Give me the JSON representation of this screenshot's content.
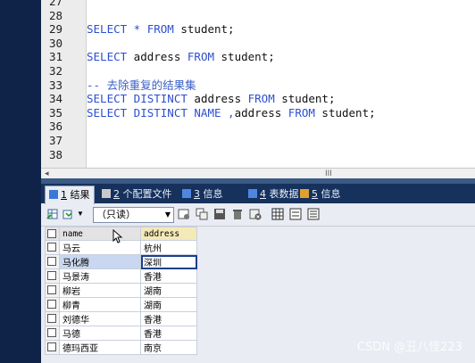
{
  "editor": {
    "lines": [
      {
        "num": "27",
        "segments": []
      },
      {
        "num": "28",
        "segments": []
      },
      {
        "num": "29",
        "segments": [
          {
            "t": "SELECT * FROM",
            "c": "kw"
          },
          {
            "t": " student;",
            "c": ""
          }
        ]
      },
      {
        "num": "30",
        "segments": []
      },
      {
        "num": "31",
        "segments": [
          {
            "t": "SELECT",
            "c": "kw"
          },
          {
            "t": " address ",
            "c": ""
          },
          {
            "t": "FROM",
            "c": "kw"
          },
          {
            "t": " student;",
            "c": ""
          }
        ]
      },
      {
        "num": "32",
        "segments": []
      },
      {
        "num": "33",
        "segments": [
          {
            "t": "-- 去除重复的结果集",
            "c": "cm"
          }
        ]
      },
      {
        "num": "34",
        "segments": [
          {
            "t": "SELECT DISTINCT",
            "c": "kw"
          },
          {
            "t": " address ",
            "c": ""
          },
          {
            "t": "FROM",
            "c": "kw"
          },
          {
            "t": " student;",
            "c": ""
          }
        ]
      },
      {
        "num": "35",
        "segments": [
          {
            "t": "SELECT DISTINCT NAME ,",
            "c": "kw"
          },
          {
            "t": "address ",
            "c": ""
          },
          {
            "t": "FROM",
            "c": "kw"
          },
          {
            "t": " student;",
            "c": ""
          }
        ]
      },
      {
        "num": "36",
        "segments": []
      },
      {
        "num": "37",
        "segments": []
      },
      {
        "num": "38",
        "segments": []
      }
    ],
    "scroll_grip": "III"
  },
  "tabs": [
    {
      "num": "1",
      "label": "结果",
      "active": true,
      "icon": "results-grid-icon",
      "color": "#3a78d6"
    },
    {
      "num": "2",
      "label": "个配置文件",
      "active": false,
      "icon": "profile-icon",
      "color": "#c9c9c9"
    },
    {
      "num": "3",
      "label": "信息",
      "active": false,
      "icon": "info-icon",
      "color": "#4f86e0"
    },
    {
      "num": "4",
      "label": "表数据",
      "active": false,
      "icon": "table-data-icon",
      "color": "#4f86e0"
    },
    {
      "num": "5",
      "label": "信息",
      "active": false,
      "icon": "messages-icon",
      "color": "#e0a030"
    }
  ],
  "toolbar": {
    "mode": "（只读）"
  },
  "grid": {
    "columns": [
      "name",
      "address"
    ],
    "rows": [
      [
        "马云",
        "杭州"
      ],
      [
        "马化腾",
        "深圳"
      ],
      [
        "马景涛",
        "香港"
      ],
      [
        "柳岩",
        "湖南"
      ],
      [
        "柳青",
        "湖南"
      ],
      [
        "刘德华",
        "香港"
      ],
      [
        "马德",
        "香港"
      ],
      [
        "德玛西亚",
        "南京"
      ]
    ],
    "selected_row": 1
  },
  "watermark": "CSDN @丑八怪223"
}
